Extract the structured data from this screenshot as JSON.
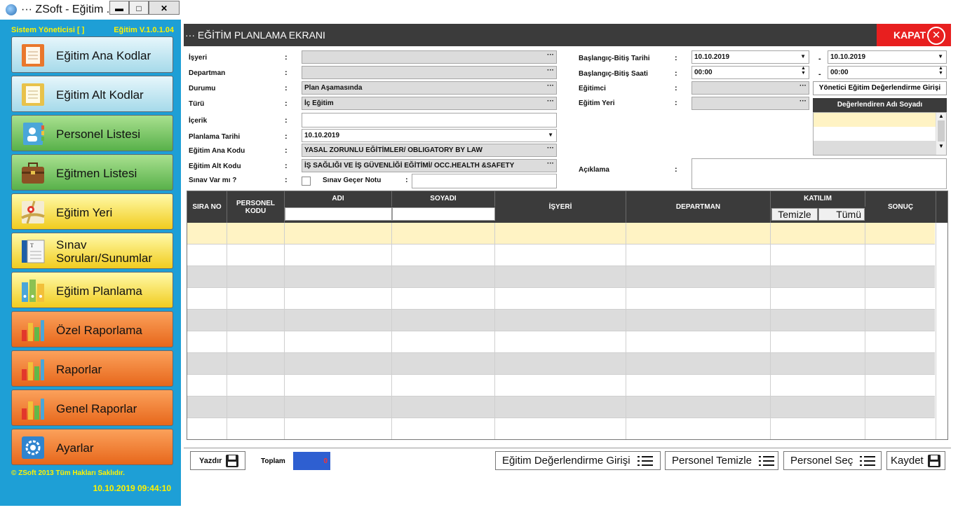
{
  "window": {
    "title": "··· ZSoft - Eğitim ...",
    "min": "▬",
    "max": "□",
    "close": "✕"
  },
  "sidebar": {
    "user": "Sistem Yöneticisi [ ]",
    "version": "Eğitim V.1.0.1.04",
    "items": [
      {
        "label": "Eğitim Ana Kodlar",
        "color": "blue",
        "icon": "document-icon"
      },
      {
        "label": "Eğitim Alt Kodlar",
        "color": "blue",
        "icon": "document-icon"
      },
      {
        "label": "Personel Listesi",
        "color": "green",
        "icon": "address-book-icon"
      },
      {
        "label": "Eğitmen Listesi",
        "color": "green",
        "icon": "briefcase-icon"
      },
      {
        "label": "Eğitim Yeri",
        "color": "yellow",
        "icon": "map-icon"
      },
      {
        "label": "Sınav Soruları/Sunumlar",
        "color": "yellow",
        "icon": "book-icon"
      },
      {
        "label": "Eğitim Planlama",
        "color": "yellow",
        "icon": "binders-icon"
      },
      {
        "label": "Özel Raporlama",
        "color": "orange",
        "icon": "bar-chart-icon"
      },
      {
        "label": "Raporlar",
        "color": "orange",
        "icon": "bar-chart-icon"
      },
      {
        "label": "Genel Raporlar",
        "color": "orange",
        "icon": "bar-chart-icon"
      },
      {
        "label": "Ayarlar",
        "color": "orange",
        "icon": "settings-icon"
      }
    ],
    "copyright": "© ZSoft 2013 Tüm Hakları Saklıdır.",
    "datetime": "10.10.2019 09:44:10"
  },
  "header": {
    "title": "··· EĞİTİM PLANLAMA EKRANI",
    "close_label": "KAPAT",
    "close_glyph": "✕"
  },
  "form": {
    "labels": {
      "isyeri": "İşyeri",
      "departman": "Departman",
      "durumu": "Durumu",
      "turu": "Türü",
      "icerik": "İçerik",
      "planlama_tarihi": "Planlama Tarihi",
      "ana_kodu": "Eğitim Ana Kodu",
      "alt_kodu": "Eğitim Alt Kodu",
      "sinav_var": "Sınav Var mı ?",
      "gecer_notu": "Sınav Geçer Notu",
      "bas_bit_tarih": "Başlangıç-Bitiş Tarihi",
      "bas_bit_saat": "Başlangıç-Bitiş Saati",
      "egitimci": "Eğitimci",
      "egitim_yeri": "Eğitim Yeri",
      "aciklama": "Açıklama"
    },
    "colon": ":",
    "dash": "-",
    "dots": "···",
    "caret": "▼",
    "spin": "▲▼",
    "values": {
      "durumu": "Plan Aşamasında",
      "turu": "İç Eğitim",
      "planlama_tarihi": "10.10.2019",
      "ana_kodu": "YASAL ZORUNLU EĞİTİMLER/ OBLIGATORY BY LAW",
      "alt_kodu": "İŞ SAĞLIĞI VE İŞ GÜVENLİĞİ EĞİTİMİ/ OCC.HEALTH &SAFETY",
      "bas_tarih": "10.10.2019",
      "bit_tarih": "10.10.2019",
      "bas_saat": "00:00",
      "bit_saat": "00:00"
    },
    "yonetici_button": "Yönetici Eğitim Değerlendirme Girişi",
    "eval_header": "Değerlendiren Adı Soyadı",
    "scroll_up": "▲",
    "scroll_down": "▼"
  },
  "grid": {
    "columns": {
      "sira": "SIRA NO",
      "personel": "PERSONEL KODU",
      "adi": "ADI",
      "soyadi": "SOYADI",
      "isyeri": "İŞYERİ",
      "departman": "DEPARTMAN",
      "katilim": "KATILIM",
      "sonuc": "SONUÇ"
    },
    "temizle": "Temizle",
    "tumu": "Tümü"
  },
  "footer": {
    "yazdir": "Yazdır",
    "toplam_label": "Toplam",
    "toplam_value": "0",
    "degerlendirme": "Eğitim Değerlendirme Girişi",
    "personel_temizle": "Personel Temizle",
    "personel_sec": "Personel Seç",
    "kaydet": "Kaydet"
  }
}
